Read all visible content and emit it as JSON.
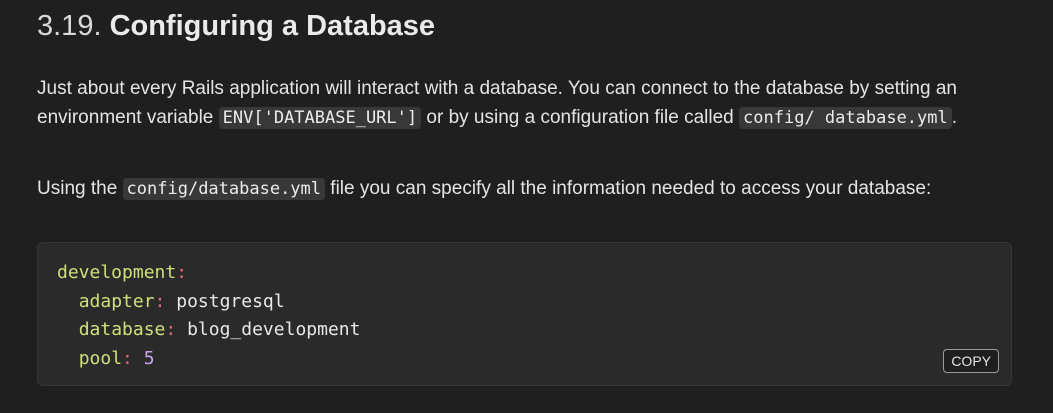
{
  "section": {
    "number": "3.19.",
    "title": "Configuring a Database"
  },
  "paragraph1": {
    "part1": "Just about every Rails application will interact with a database. You can connect to the database by setting an environment variable ",
    "code1": "ENV['DATABASE_URL']",
    "part2": " or by using a configuration file called ",
    "code2": "config/ database.yml",
    "part3": "."
  },
  "paragraph2": {
    "part1": "Using the ",
    "code1": "config/database.yml",
    "part2": " file you can specify all the information needed to access your database:"
  },
  "code_block": {
    "lines": [
      {
        "key": "development",
        "sep": ":",
        "value": "",
        "indent": ""
      },
      {
        "key": "adapter",
        "sep": ":",
        "value": " postgresql",
        "indent": "  "
      },
      {
        "key": "database",
        "sep": ":",
        "value": " blog_development",
        "indent": "  "
      },
      {
        "key": "pool",
        "sep": ":",
        "value": " 5",
        "indent": "  "
      }
    ],
    "copy_label": "COPY"
  },
  "colors": {
    "background": "#1f1f1f",
    "code_bg": "#2a2a2a",
    "yaml_key": "#cfe07a",
    "yaml_punct": "#e06c75",
    "yaml_number": "#c8a4e8"
  }
}
